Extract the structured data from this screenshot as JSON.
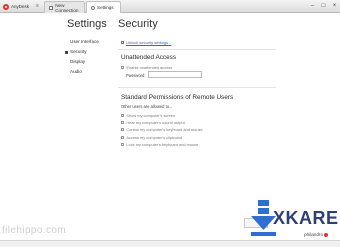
{
  "titlebar": {
    "app_name": "AnyDesk",
    "tabs": [
      {
        "label": "New Connection",
        "active": false
      },
      {
        "label": "Settings",
        "active": true
      }
    ],
    "window_buttons": [
      "–",
      "□",
      "×"
    ]
  },
  "nav": {
    "heading": "Settings",
    "items": [
      {
        "label": "User Interface",
        "active": false
      },
      {
        "label": "Security",
        "active": true
      },
      {
        "label": "Display",
        "active": false
      },
      {
        "label": "Audio",
        "active": false
      }
    ]
  },
  "content": {
    "title": "Security",
    "unlock_link": "Unlock security settings...",
    "unattended": {
      "heading": "Unattended Access",
      "checkbox_label": "Enable unattended access",
      "password_label": "Password:",
      "password_value": ""
    },
    "permissions": {
      "heading": "Standard Permissions of Remote Users",
      "subheading": "Other users are allowed to...",
      "items": [
        "Hear my computer's sound output",
        "Control my computer's keyboard and mouse",
        "Access my computer's clipboard",
        "Lock my computer's keyboard and mouse",
        "Show my computer's screen"
      ]
    }
  },
  "overlay": {
    "brand_small": "philandro",
    "logo_text": "XKARE",
    "watermark": "filehippo.com"
  },
  "colors": {
    "accent_red": "#e0332d",
    "link_blue": "#4a63a8",
    "logo_blue": "#2d3f73"
  }
}
